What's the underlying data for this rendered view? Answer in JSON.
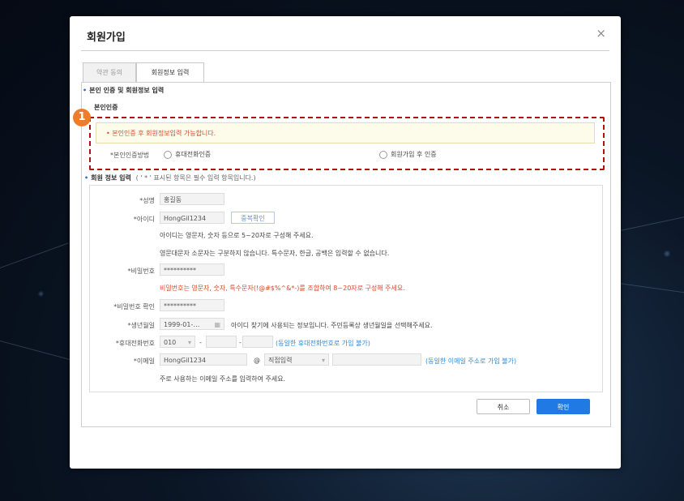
{
  "modal": {
    "title": "회원가입",
    "close": "×"
  },
  "tabs": [
    {
      "label": "약관 동의",
      "active": false
    },
    {
      "label": "회원정보 입력",
      "active": true
    }
  ],
  "section1": {
    "title": "본인 인증 및 회원정보 입력",
    "subtitle": "본인인증"
  },
  "callout_number": "1",
  "notice": "• 본인인증 후 회원정보입력 가능합니다.",
  "cert": {
    "label": "*본인인증방법",
    "option1": "휴대전화인증",
    "option2": "회원가입 후 인증"
  },
  "section2": {
    "title": "회원 정보 입력",
    "note": "( ' * ' 표시된 항목은 필수 입력 항목입니다.)"
  },
  "form": {
    "name": {
      "label": "*성명",
      "value": "홍길동"
    },
    "id": {
      "label": "*아이디",
      "value": "HongGil1234",
      "button": "중복확인",
      "hint1": "아이디는 영문자, 숫자 등으로 5~20자로 구성해 주세요.",
      "hint2": "영문대문자 소문자는 구분하지 않습니다. 특수문자, 한글, 공백은 입력할 수 없습니다."
    },
    "password": {
      "label": "*비밀번호",
      "value": "**********",
      "hint": "비밀번호는 영문자, 숫자, 특수문자(!@#$%^&*-)를 조합하여 8~20자로 구성해 주세요."
    },
    "password_confirm": {
      "label": "*비밀번호 확인",
      "value": "**********"
    },
    "birth": {
      "label": "*생년월일",
      "value": "1999-01-…",
      "hint": "아이디 찾기에 사용되는 정보입니다. 주민등록상 생년월일을 선택해주세요."
    },
    "phone": {
      "label": "*휴대전화번호",
      "prefix": "010",
      "sep1": "-",
      "sep2": "-",
      "hint": "(동일한 휴대전화번호로 가입 불가)"
    },
    "email": {
      "label": "*이메일",
      "local": "HongGil1234",
      "at": "@",
      "domain_select": "직접입력",
      "hint": "(동일한 이메일 주소로 가입 불가)",
      "hint2": "주로 사용하는 이메일 주소를 입력하여 주세요."
    }
  },
  "buttons": {
    "cancel": "취소",
    "confirm": "확인"
  },
  "colors": {
    "accent": "#1f7be3",
    "warning": "#d94a2a",
    "callout": "#ee7d2a",
    "highlight_border": "#b01212"
  }
}
